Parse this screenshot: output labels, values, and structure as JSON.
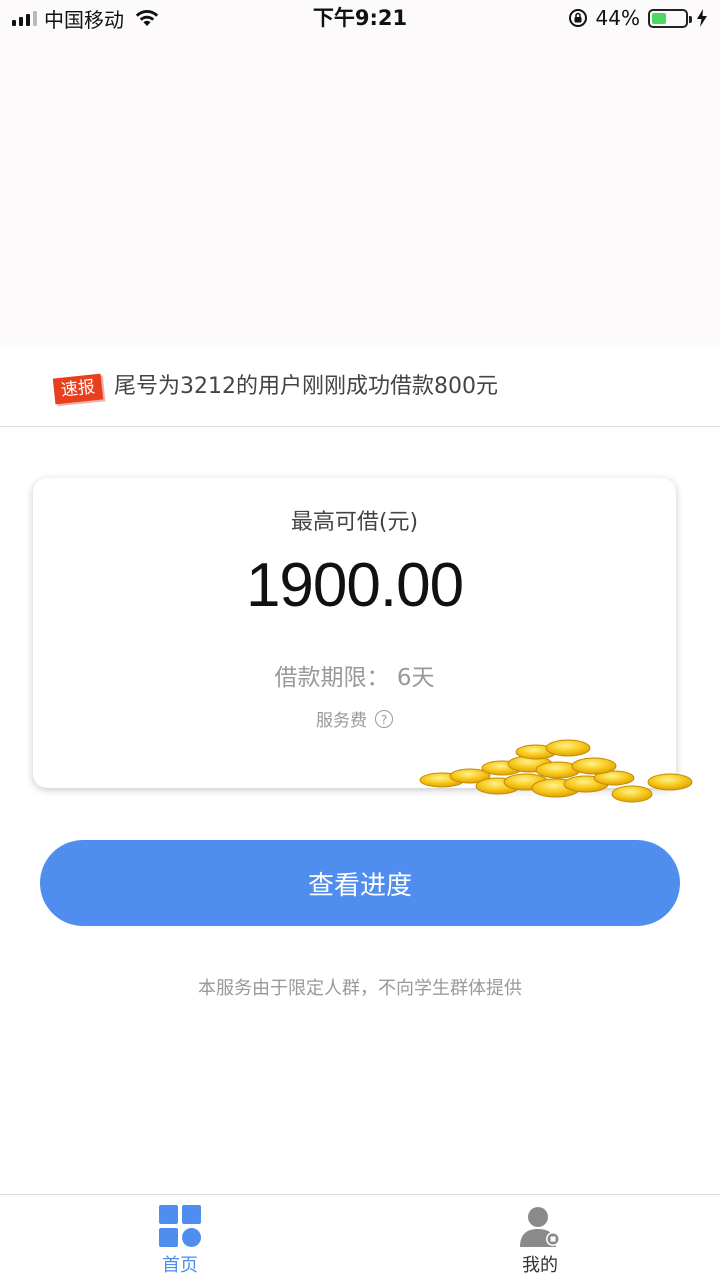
{
  "status_bar": {
    "carrier": "中国移动",
    "time": "下午9:21",
    "battery_percent": "44%",
    "battery_level": 0.44,
    "battery_color": "#4cd964"
  },
  "ticker": {
    "badge": "速报",
    "text": "尾号为3212的用户刚刚成功借款800元",
    "badge_color": "#e8401c"
  },
  "loan_card": {
    "label": "最高可借(元)",
    "amount": "1900.00",
    "term": "借款期限：  6天",
    "fee_label": "服务费",
    "fee_help_icon": "question-circle-icon",
    "decoration_icon": "gold-coins-icon"
  },
  "primary_button": {
    "label": "查看进度",
    "color": "#4f8def"
  },
  "notice": "本服务由于限定人群，不向学生群体提供",
  "tab_bar": {
    "tabs": [
      {
        "label": "首页",
        "icon": "home-grid-icon",
        "active": true
      },
      {
        "label": "我的",
        "icon": "user-profile-icon",
        "active": false
      }
    ],
    "active_color": "#4f8def"
  }
}
